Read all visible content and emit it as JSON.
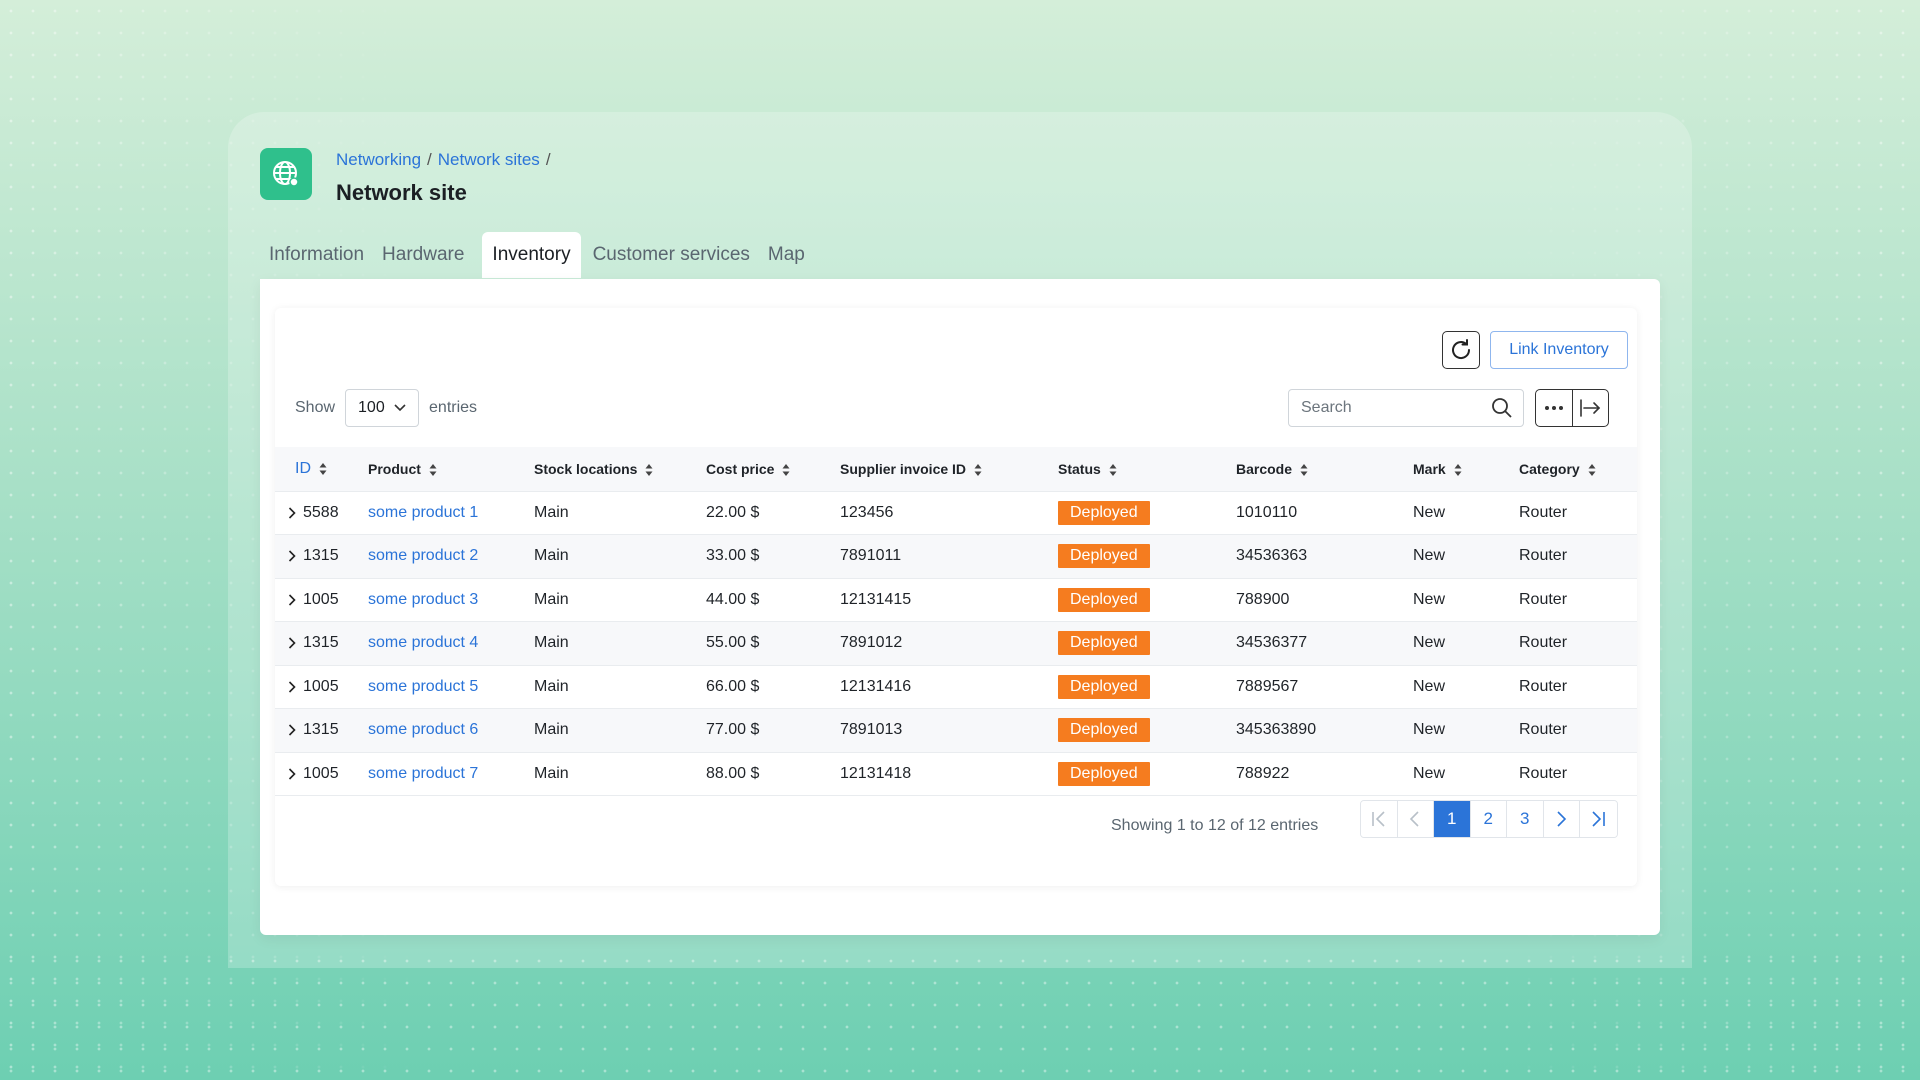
{
  "breadcrumb": {
    "items": [
      "Networking",
      "Network sites"
    ],
    "separator": "/"
  },
  "page": {
    "title": "Network site"
  },
  "tabs": [
    {
      "label": "Information",
      "active": false
    },
    {
      "label": "Hardware",
      "active": false
    },
    {
      "label": "Inventory",
      "active": true
    },
    {
      "label": "Customer services",
      "active": false
    },
    {
      "label": "Map",
      "active": false
    }
  ],
  "toolbar": {
    "link_inventory_label": "Link Inventory",
    "refresh_icon": "refresh-icon"
  },
  "entries": {
    "show_label": "Show",
    "page_size": "100",
    "entries_label": "entries"
  },
  "search": {
    "placeholder": "Search"
  },
  "table": {
    "columns": [
      "ID",
      "Product",
      "Stock locations",
      "Cost price",
      "Supplier invoice ID",
      "Status",
      "Barcode",
      "Mark",
      "Category"
    ],
    "rows": [
      {
        "id": "5588",
        "product": "some product 1",
        "stock": "Main",
        "cost": "22.00 $",
        "invoice": "123456",
        "status": "Deployed",
        "barcode": "1010110",
        "mark": "New",
        "category": "Router"
      },
      {
        "id": "1315",
        "product": "some product 2",
        "stock": "Main",
        "cost": "33.00 $",
        "invoice": "7891011",
        "status": "Deployed",
        "barcode": "34536363",
        "mark": "New",
        "category": "Router"
      },
      {
        "id": "1005",
        "product": "some product 3",
        "stock": "Main",
        "cost": "44.00 $",
        "invoice": "12131415",
        "status": "Deployed",
        "barcode": "788900",
        "mark": "New",
        "category": "Router"
      },
      {
        "id": "1315",
        "product": "some product 4",
        "stock": "Main",
        "cost": "55.00 $",
        "invoice": "7891012",
        "status": "Deployed",
        "barcode": "34536377",
        "mark": "New",
        "category": "Router"
      },
      {
        "id": "1005",
        "product": "some product 5",
        "stock": "Main",
        "cost": "66.00 $",
        "invoice": "12131416",
        "status": "Deployed",
        "barcode": "7889567",
        "mark": "New",
        "category": "Router"
      },
      {
        "id": "1315",
        "product": "some product 6",
        "stock": "Main",
        "cost": "77.00 $",
        "invoice": "7891013",
        "status": "Deployed",
        "barcode": "345363890",
        "mark": "New",
        "category": "Router"
      },
      {
        "id": "1005",
        "product": "some product 7",
        "stock": "Main",
        "cost": "88.00 $",
        "invoice": "12131418",
        "status": "Deployed",
        "barcode": "788922",
        "mark": "New",
        "category": "Router"
      }
    ]
  },
  "footer": {
    "info": "Showing 1 to 12 of 12 entries",
    "pages": [
      "1",
      "2",
      "3"
    ],
    "current_page": "1"
  },
  "colors": {
    "accent": "#2b74d8",
    "status_deployed": "#f57c1f",
    "app_icon": "#2fc08c"
  }
}
